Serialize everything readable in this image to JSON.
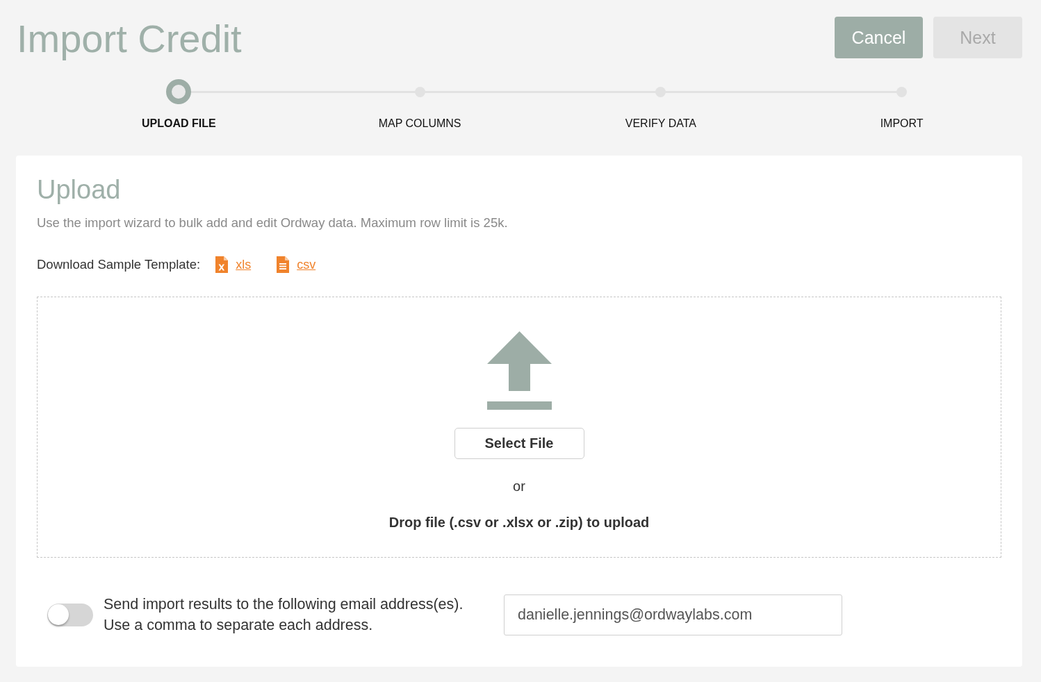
{
  "header": {
    "title": "Import Credit",
    "buttons": [
      {
        "label": "Cancel",
        "kind": "secondary",
        "disabled": false
      },
      {
        "label": "Next",
        "kind": "primary",
        "disabled": true
      }
    ]
  },
  "stepper": {
    "steps": [
      {
        "label": "UPLOAD FILE",
        "selected": true
      },
      {
        "label": "MAP COLUMNS",
        "selected": false
      },
      {
        "label": "VERIFY DATA",
        "selected": false
      },
      {
        "label": "IMPORT",
        "selected": false
      }
    ]
  },
  "upload": {
    "title": "Upload",
    "description": "Use the import wizard to bulk add and edit Ordway data. Maximum row limit is 25k.",
    "template": {
      "label": "Download Sample Template:",
      "links": [
        {
          "label": "xls",
          "kind": "xls"
        },
        {
          "label": "csv",
          "kind": "csv"
        }
      ]
    },
    "dropzone": {
      "button": "Select File",
      "separator": "or",
      "hint": "Drop file (.csv or .xlsx or .zip) to upload"
    }
  },
  "email": {
    "on": false,
    "lines": [
      "Send import results to the following email address(es).",
      "Use a comma to separate each address."
    ],
    "value": "danielle.jennings@ordwaylabs.com"
  }
}
